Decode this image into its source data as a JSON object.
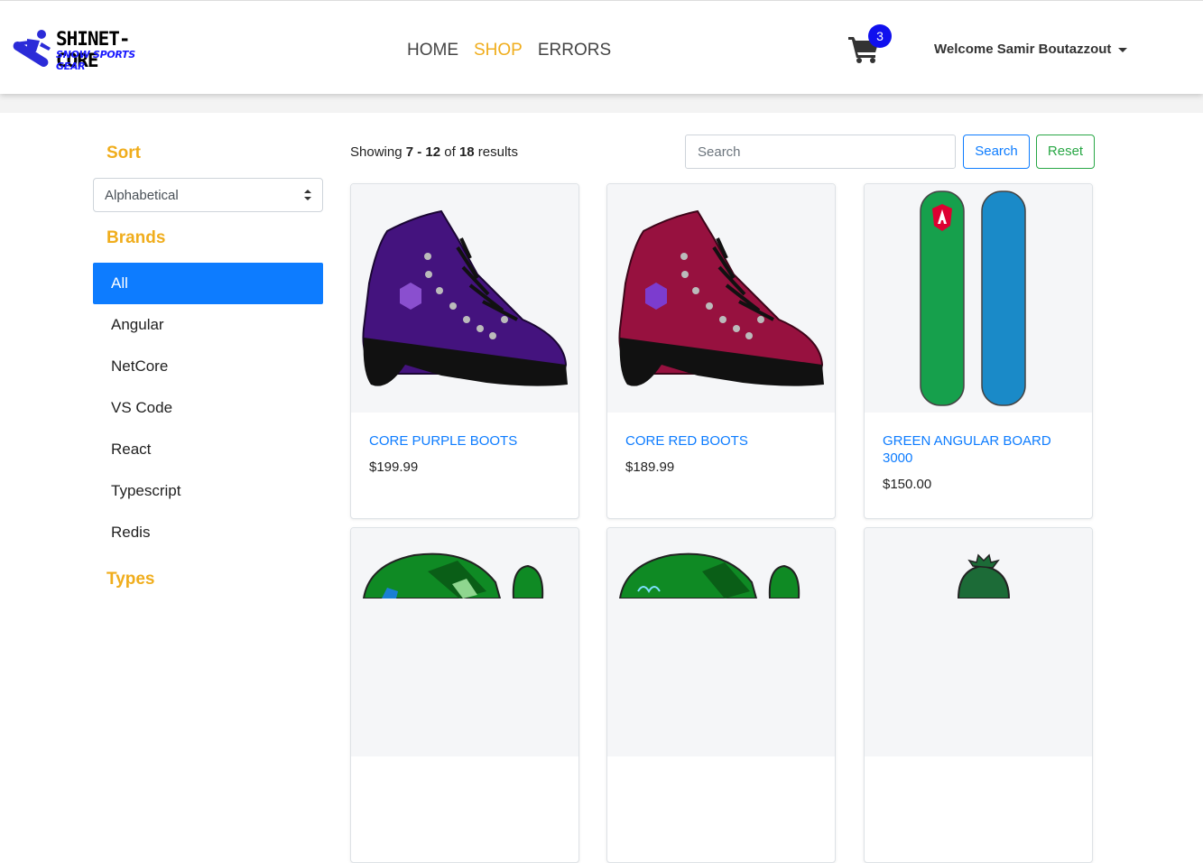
{
  "header": {
    "logo_title": "SHINET-CORE",
    "logo_subtitle": "SNOW SPORTS GEAR",
    "nav": [
      {
        "label": "HOME",
        "active": false
      },
      {
        "label": "SHOP",
        "active": true
      },
      {
        "label": "ERRORS",
        "active": false
      }
    ],
    "cart_count": "3",
    "welcome": "Welcome Samir Boutazzout",
    "accent_color": "#f0ad1c",
    "badge_color": "#1010ee"
  },
  "sidebar": {
    "sort_title": "Sort",
    "sort_selected": "Alphabetical",
    "brands_title": "Brands",
    "brands": [
      "All",
      "Angular",
      "NetCore",
      "VS Code",
      "React",
      "Typescript",
      "Redis"
    ],
    "brands_selected": "All",
    "types_title": "Types"
  },
  "toolbar": {
    "showing_prefix": "Showing",
    "range": "7 - 12",
    "of_label": "of",
    "total": "18",
    "results_label": "results",
    "search_placeholder": "Search",
    "search_button": "Search",
    "reset_button": "Reset"
  },
  "products": [
    {
      "name": "CORE PURPLE BOOTS",
      "price": "$199.99",
      "image": "purple-boot-icon"
    },
    {
      "name": "CORE RED BOOTS",
      "price": "$189.99",
      "image": "red-boot-icon"
    },
    {
      "name": "GREEN ANGULAR BOARD 3000",
      "price": "$150.00",
      "image": "snowboard-icon"
    },
    {
      "name": "",
      "price": "",
      "image": "green-glove-icon"
    },
    {
      "name": "",
      "price": "",
      "image": "green-glove-icon"
    },
    {
      "name": "",
      "price": "",
      "image": "green-hat-icon"
    }
  ],
  "colors": {
    "primary": "#0d7cff",
    "success": "#28a745"
  }
}
